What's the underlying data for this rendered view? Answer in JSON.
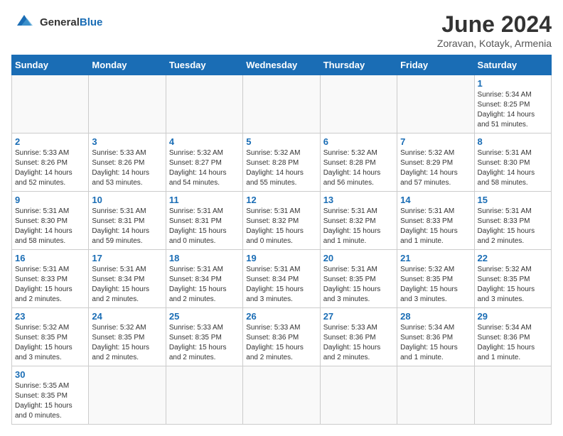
{
  "header": {
    "logo_general": "General",
    "logo_blue": "Blue",
    "title": "June 2024",
    "subtitle": "Zoravan, Kotayk, Armenia"
  },
  "weekdays": [
    "Sunday",
    "Monday",
    "Tuesday",
    "Wednesday",
    "Thursday",
    "Friday",
    "Saturday"
  ],
  "weeks": [
    [
      {
        "day": "",
        "info": ""
      },
      {
        "day": "",
        "info": ""
      },
      {
        "day": "",
        "info": ""
      },
      {
        "day": "",
        "info": ""
      },
      {
        "day": "",
        "info": ""
      },
      {
        "day": "",
        "info": ""
      },
      {
        "day": "1",
        "info": "Sunrise: 5:34 AM\nSunset: 8:25 PM\nDaylight: 14 hours and 51 minutes."
      }
    ],
    [
      {
        "day": "2",
        "info": "Sunrise: 5:33 AM\nSunset: 8:26 PM\nDaylight: 14 hours and 52 minutes."
      },
      {
        "day": "3",
        "info": "Sunrise: 5:33 AM\nSunset: 8:26 PM\nDaylight: 14 hours and 53 minutes."
      },
      {
        "day": "4",
        "info": "Sunrise: 5:32 AM\nSunset: 8:27 PM\nDaylight: 14 hours and 54 minutes."
      },
      {
        "day": "5",
        "info": "Sunrise: 5:32 AM\nSunset: 8:28 PM\nDaylight: 14 hours and 55 minutes."
      },
      {
        "day": "6",
        "info": "Sunrise: 5:32 AM\nSunset: 8:28 PM\nDaylight: 14 hours and 56 minutes."
      },
      {
        "day": "7",
        "info": "Sunrise: 5:32 AM\nSunset: 8:29 PM\nDaylight: 14 hours and 57 minutes."
      },
      {
        "day": "8",
        "info": "Sunrise: 5:31 AM\nSunset: 8:30 PM\nDaylight: 14 hours and 58 minutes."
      }
    ],
    [
      {
        "day": "9",
        "info": "Sunrise: 5:31 AM\nSunset: 8:30 PM\nDaylight: 14 hours and 58 minutes."
      },
      {
        "day": "10",
        "info": "Sunrise: 5:31 AM\nSunset: 8:31 PM\nDaylight: 14 hours and 59 minutes."
      },
      {
        "day": "11",
        "info": "Sunrise: 5:31 AM\nSunset: 8:31 PM\nDaylight: 15 hours and 0 minutes."
      },
      {
        "day": "12",
        "info": "Sunrise: 5:31 AM\nSunset: 8:32 PM\nDaylight: 15 hours and 0 minutes."
      },
      {
        "day": "13",
        "info": "Sunrise: 5:31 AM\nSunset: 8:32 PM\nDaylight: 15 hours and 1 minute."
      },
      {
        "day": "14",
        "info": "Sunrise: 5:31 AM\nSunset: 8:33 PM\nDaylight: 15 hours and 1 minute."
      },
      {
        "day": "15",
        "info": "Sunrise: 5:31 AM\nSunset: 8:33 PM\nDaylight: 15 hours and 2 minutes."
      }
    ],
    [
      {
        "day": "16",
        "info": "Sunrise: 5:31 AM\nSunset: 8:33 PM\nDaylight: 15 hours and 2 minutes."
      },
      {
        "day": "17",
        "info": "Sunrise: 5:31 AM\nSunset: 8:34 PM\nDaylight: 15 hours and 2 minutes."
      },
      {
        "day": "18",
        "info": "Sunrise: 5:31 AM\nSunset: 8:34 PM\nDaylight: 15 hours and 2 minutes."
      },
      {
        "day": "19",
        "info": "Sunrise: 5:31 AM\nSunset: 8:34 PM\nDaylight: 15 hours and 3 minutes."
      },
      {
        "day": "20",
        "info": "Sunrise: 5:31 AM\nSunset: 8:35 PM\nDaylight: 15 hours and 3 minutes."
      },
      {
        "day": "21",
        "info": "Sunrise: 5:32 AM\nSunset: 8:35 PM\nDaylight: 15 hours and 3 minutes."
      },
      {
        "day": "22",
        "info": "Sunrise: 5:32 AM\nSunset: 8:35 PM\nDaylight: 15 hours and 3 minutes."
      }
    ],
    [
      {
        "day": "23",
        "info": "Sunrise: 5:32 AM\nSunset: 8:35 PM\nDaylight: 15 hours and 3 minutes."
      },
      {
        "day": "24",
        "info": "Sunrise: 5:32 AM\nSunset: 8:35 PM\nDaylight: 15 hours and 2 minutes."
      },
      {
        "day": "25",
        "info": "Sunrise: 5:33 AM\nSunset: 8:35 PM\nDaylight: 15 hours and 2 minutes."
      },
      {
        "day": "26",
        "info": "Sunrise: 5:33 AM\nSunset: 8:36 PM\nDaylight: 15 hours and 2 minutes."
      },
      {
        "day": "27",
        "info": "Sunrise: 5:33 AM\nSunset: 8:36 PM\nDaylight: 15 hours and 2 minutes."
      },
      {
        "day": "28",
        "info": "Sunrise: 5:34 AM\nSunset: 8:36 PM\nDaylight: 15 hours and 1 minute."
      },
      {
        "day": "29",
        "info": "Sunrise: 5:34 AM\nSunset: 8:36 PM\nDaylight: 15 hours and 1 minute."
      }
    ],
    [
      {
        "day": "30",
        "info": "Sunrise: 5:35 AM\nSunset: 8:35 PM\nDaylight: 15 hours and 0 minutes."
      },
      {
        "day": "",
        "info": ""
      },
      {
        "day": "",
        "info": ""
      },
      {
        "day": "",
        "info": ""
      },
      {
        "day": "",
        "info": ""
      },
      {
        "day": "",
        "info": ""
      },
      {
        "day": "",
        "info": ""
      }
    ]
  ]
}
